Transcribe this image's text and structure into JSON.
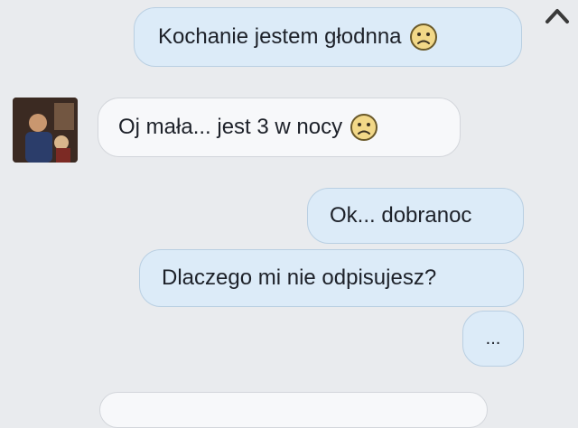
{
  "messages": [
    {
      "text": "Kochanie jestem głodnna",
      "direction": "outgoing",
      "emoji": "sad-face"
    },
    {
      "text": "Oj mała... jest 3 w nocy",
      "direction": "incoming",
      "emoji": "sad-face"
    },
    {
      "text": "Ok... dobranoc",
      "direction": "outgoing"
    },
    {
      "text": "Dlaczego mi nie odpisujesz?",
      "direction": "outgoing"
    },
    {
      "text": "...",
      "direction": "outgoing"
    }
  ],
  "colors": {
    "outgoing_bubble": "#dcebf8",
    "incoming_bubble": "#f7f8fa",
    "background": "#e9ebee",
    "emoji_fill": "#f2d888"
  },
  "icons": {
    "scroll": "chevron-up-icon",
    "emoji": "sad-face-icon"
  }
}
